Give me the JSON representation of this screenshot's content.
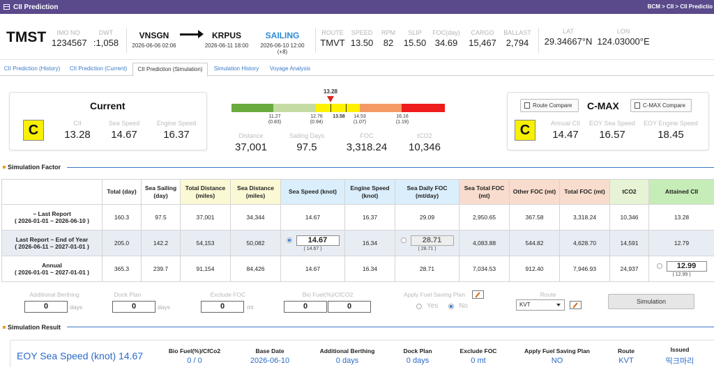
{
  "app": {
    "title": "CII Prediction",
    "breadcrumb": "BCM > CII > CII Predictio"
  },
  "vessel": {
    "name": "TMST",
    "imo_label": "IMO NO",
    "imo": "1234567",
    "dwt_label": "DWT",
    "dwt": ":1,058",
    "from_port": "VNSGN",
    "from_time": "2026-06-06 02:06",
    "to_port": "KRPUS",
    "to_time": "2026-06-11 18:00",
    "status": "SAILING",
    "status_time": "2026-06-10 12:00 (+8)",
    "route_label": "ROUTE",
    "route": "TMVT",
    "speed_label": "SPEED",
    "speed": "13.50",
    "rpm_label": "RPM",
    "rpm": "82",
    "slip_label": "SLIP",
    "slip": "15.50",
    "foc_label": "FOC(day)",
    "foc": "34.69",
    "cargo_label": "CARGO",
    "cargo": "15,467",
    "ballast_label": "BALLAST",
    "ballast": "2,794",
    "lat_label": "LAT",
    "lat": "29.34667°N",
    "lon_label": "LON",
    "lon": "124.03000°E"
  },
  "tabs": [
    "CII Prediction (History)",
    "CII Prediction (Current)",
    "CII Prediction (Simulation)",
    "Simulation History",
    "Voyage Analysis"
  ],
  "current": {
    "title": "Current",
    "grade": "C",
    "cii_label": "CII",
    "cii": "13.28",
    "sea_speed_label": "Sea Speed",
    "sea_speed": "14.67",
    "engine_speed_label": "Engine Speed",
    "engine_speed": "16.37"
  },
  "gauge": {
    "pointer_value": "13.28",
    "colors": [
      "#6aab3e",
      "#c4dca4",
      "#fff200",
      "#f49a66",
      "#ee1c1c"
    ],
    "bounds": [
      {
        "v": "11.27",
        "r": "(0.83)"
      },
      {
        "v": "12.76",
        "r": "(0.94)"
      },
      {
        "v": "13.58",
        "r": ""
      },
      {
        "v": "14.53",
        "r": "(1.07)"
      },
      {
        "v": "16.16",
        "r": "(1.19)"
      }
    ],
    "distance_label": "Distance",
    "distance": "37,001",
    "sailing_days_label": "Sailing Days",
    "sailing_days": "97.5",
    "foc_label": "FOC",
    "foc": "3,318.24",
    "tco2_label": "tCO2",
    "tco2": "10,346"
  },
  "cmax": {
    "title": "C-MAX",
    "grade": "C",
    "route_compare": "Route Compare",
    "cmax_compare": "C-MAX Compare",
    "annual_cii_label": "Annual CII",
    "annual_cii": "14.47",
    "eoy_sea_label": "EOY Sea Speed",
    "eoy_sea": "16.57",
    "eoy_engine_label": "EOY Engine Speed",
    "eoy_engine": "18.45"
  },
  "sim_factor": {
    "section": "Simulation Factor",
    "headers": [
      "",
      "Total (day)",
      "Sea Sailing (day)",
      "Total Distance (miles)",
      "Sea Distance (miles)",
      "Sea Speed (knot)",
      "Engine Speed (knot)",
      "Sea Daily FOC (mt/day)",
      "Sea Total FOC (mt)",
      "Other FOC (mt)",
      "Total FOC (mt)",
      "tCO2",
      "Attained CII"
    ],
    "rows": [
      {
        "label": "~ Last Report",
        "range": "( 2026-01-01 ~ 2026-06-10 )",
        "total": "160.3",
        "sea_sailing": "97.5",
        "total_dist": "37,001",
        "sea_dist": "34,344",
        "sea_speed": "14.67",
        "engine_speed": "16.37",
        "daily_foc": "29.09",
        "sea_total_foc": "2,950.65",
        "other_foc": "367.58",
        "total_foc": "3,318.24",
        "tco2": "10,346",
        "cii": "13.28"
      },
      {
        "label": "Last Report ~ End of Year",
        "range": "( 2026-06-11 ~ 2027-01-01 )",
        "total": "205.0",
        "sea_sailing": "142.2",
        "total_dist": "54,153",
        "sea_dist": "50,082",
        "sea_speed": "14.67",
        "sea_speed_sub": "( 14.67 )",
        "engine_speed": "16.34",
        "daily_foc": "28.71",
        "daily_foc_sub": "( 28.71 )",
        "sea_total_foc": "4,083.88",
        "other_foc": "544.82",
        "total_foc": "4,628.70",
        "tco2": "14,591",
        "cii": "12.79"
      },
      {
        "label": "Annual",
        "range": "( 2026-01-01 ~ 2027-01-01 )",
        "total": "365.3",
        "sea_sailing": "239.7",
        "total_dist": "91,154",
        "sea_dist": "84,426",
        "sea_speed": "14.67",
        "engine_speed": "16.34",
        "daily_foc": "28.71",
        "sea_total_foc": "7,034.53",
        "other_foc": "912.40",
        "total_foc": "7,946.93",
        "tco2": "24,937",
        "cii": "12.99",
        "cii_sub": "( 12.99 )"
      }
    ]
  },
  "form": {
    "berthing_label": "Additional Berthing",
    "berthing": "0",
    "days1": "days",
    "dock_label": "Dock Plan",
    "dock": "0",
    "days2": "days",
    "exclude_label": "Exclude FOC",
    "exclude": "0",
    "mt": "mt",
    "bio_label": "Bio Fuel(%)/CfCO2",
    "bio1": "0",
    "bio2": "0",
    "saving_label": "Apply Fuel Saving Plan",
    "yes": "Yes",
    "no": "No",
    "route_label": "Route",
    "route": "KVT",
    "simulate": "Simulation"
  },
  "result": {
    "section": "Simulation Result",
    "eoy": "EOY Sea Speed (knot) 14.67",
    "items": [
      {
        "label": "Bio Fuel(%)/CfCo2",
        "value": "0 / 0"
      },
      {
        "label": "Base Date",
        "value": "2026-06-10"
      },
      {
        "label": "Additional Berthing",
        "value": "0 days"
      },
      {
        "label": "Dock Plan",
        "value": "0 days"
      },
      {
        "label": "Exclude FOC",
        "value": "0 mt"
      },
      {
        "label": "Apply Fuel Saving Plan",
        "value": "NO"
      },
      {
        "label": "Route",
        "value": "KVT"
      },
      {
        "label": "Issued",
        "value": "띡크마리"
      }
    ]
  }
}
